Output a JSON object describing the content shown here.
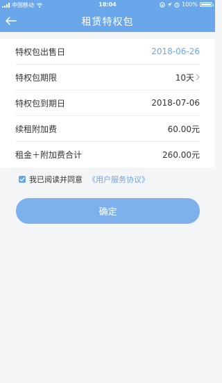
{
  "status_bar": {
    "carrier": "中国移动",
    "time": "18:04",
    "battery": "100%"
  },
  "header": {
    "title": "租赁特权包"
  },
  "rows": [
    {
      "label": "特权包出售日",
      "value": "2018-06-26"
    },
    {
      "label": "特权包期限",
      "value": "10天"
    },
    {
      "label": "特权包到期日",
      "value": "2018-07-06"
    },
    {
      "label": "续租附加费",
      "value": "60.00元"
    },
    {
      "label": "租金＋附加费合计",
      "value": "260.00元"
    }
  ],
  "agreement": {
    "checked": true,
    "text": "我已阅读并同意",
    "link": "《用户服务协议》"
  },
  "confirm_label": "确定",
  "colors": {
    "accent": "#6aa6ea",
    "button": "#7cb1ec",
    "background": "#f4f5f7"
  }
}
